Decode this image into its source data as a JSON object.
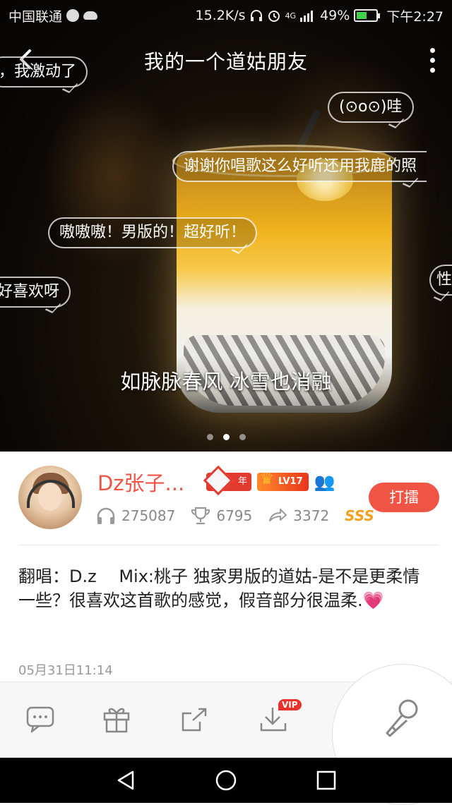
{
  "status_bar": {
    "carrier": "中国联通",
    "net_speed": "15.2K/s",
    "signal": "4G",
    "battery": "49%",
    "time": "下午2:27"
  },
  "header": {
    "title": "我的一个道姑朋友"
  },
  "danmaku": [
    "，我激动了",
    "(⊙o⊙)哇",
    "谢谢你唱歌这么好听还用我鹿的照",
    "嗷嗷嗷！男版的！超好听！",
    "好喜欢呀",
    "性"
  ],
  "lyric": "如脉脉春风 冰雪也消融",
  "carousel": {
    "current": 2,
    "total": 3
  },
  "profile": {
    "username": "Dz张子...",
    "badge_year_label": "年",
    "badge_level": "LV17",
    "listens": "275087",
    "trophies": "6795",
    "shares": "3372",
    "rank": "SSS",
    "action_label": "打擂"
  },
  "description": {
    "text": "翻唱：D.z　 Mix:桃子  独家男版的道姑-是不是更柔情一些？很喜欢这首歌的感觉，假音部分很温柔.",
    "emoji": "💗"
  },
  "timestamp": "05月31日11:14",
  "toolbar": {
    "vip_label": "VIP",
    "items": [
      "comment-icon",
      "gift-icon",
      "share-icon",
      "download-icon",
      "microphone-icon"
    ]
  },
  "colors": {
    "accent": "#f05445",
    "rank": "#f3a020",
    "muted": "#888888"
  }
}
